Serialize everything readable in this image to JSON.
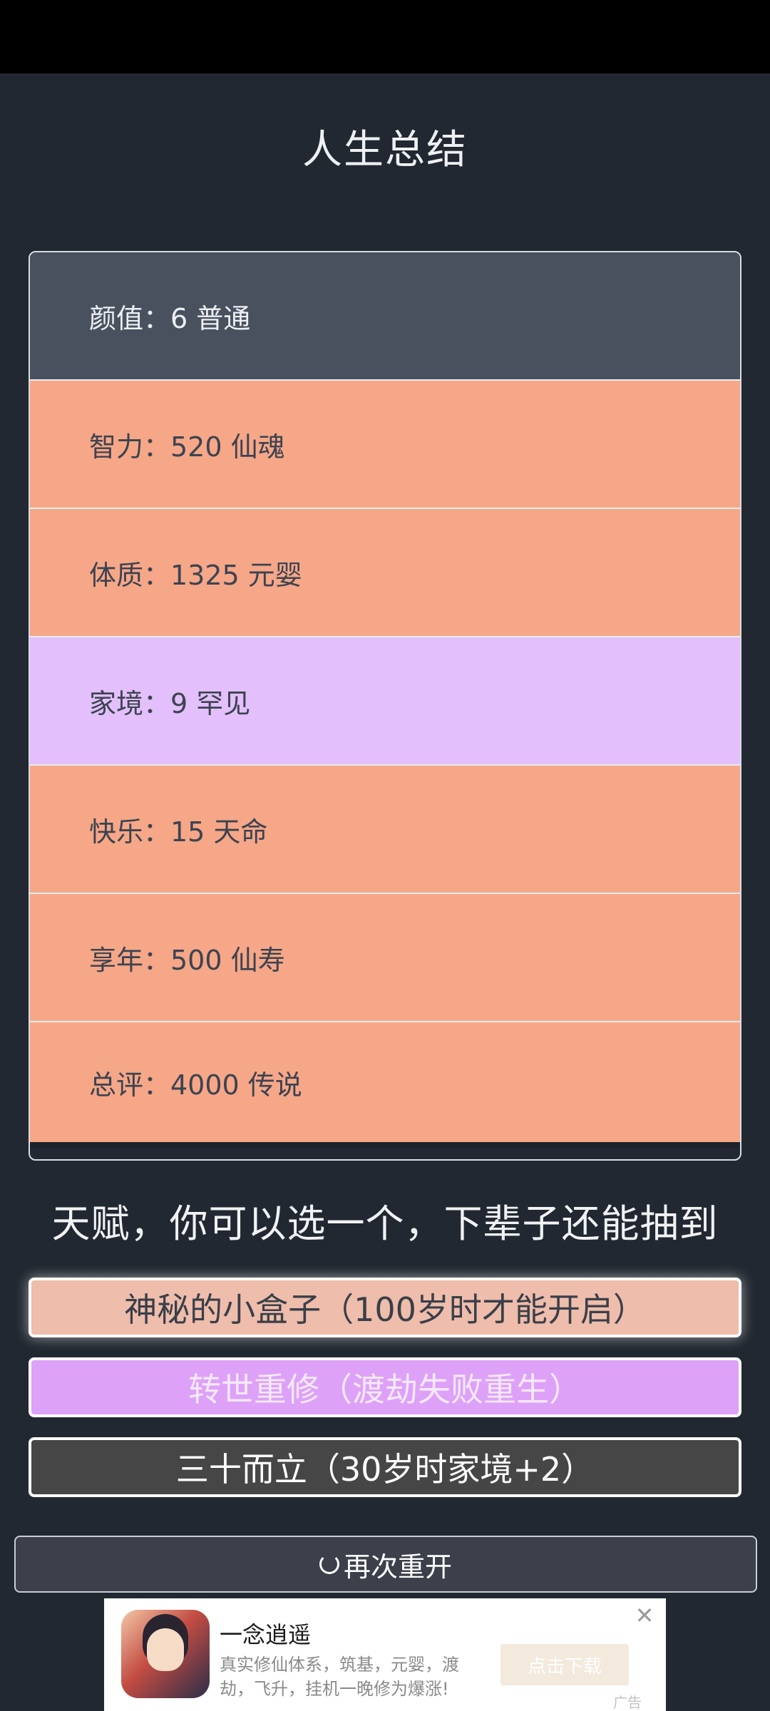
{
  "header": {
    "title": "人生总结"
  },
  "stats": [
    {
      "label": "颜值：6 普通",
      "bg": "#4a515e"
    },
    {
      "label": "智力：520 仙魂",
      "bg": "#f5a788"
    },
    {
      "label": "体质：1325 元婴",
      "bg": "#f5a788"
    },
    {
      "label": "家境：9 罕见",
      "bg": "#e3c0fb"
    },
    {
      "label": "快乐：15 天命",
      "bg": "#f5a788"
    },
    {
      "label": "享年：500 仙寿",
      "bg": "#f5a788"
    },
    {
      "label": "总评：4000 传说",
      "bg": "#f5a788"
    }
  ],
  "talents": {
    "heading": "天赋，你可以选一个，下辈子还能抽到",
    "options": [
      {
        "label": "神秘的小盒子（100岁时才能开启）"
      },
      {
        "label": "转世重修（渡劫失败重生）"
      },
      {
        "label": "三十而立（30岁时家境+2）"
      }
    ]
  },
  "restart": {
    "label": "再次重开",
    "icon": "refresh-icon"
  },
  "ad": {
    "title": "一念逍遥",
    "description": "真实修仙体系，筑基，元婴，渡劫，飞升，挂机一晚修为爆涨!",
    "download_label": "点击下载",
    "close_label": "✕",
    "ad_label": "广告"
  },
  "colors": {
    "background": "#222831",
    "grey_row": "#4a515e",
    "orange_row": "#f5a788",
    "purple_row": "#e3c0fb"
  }
}
